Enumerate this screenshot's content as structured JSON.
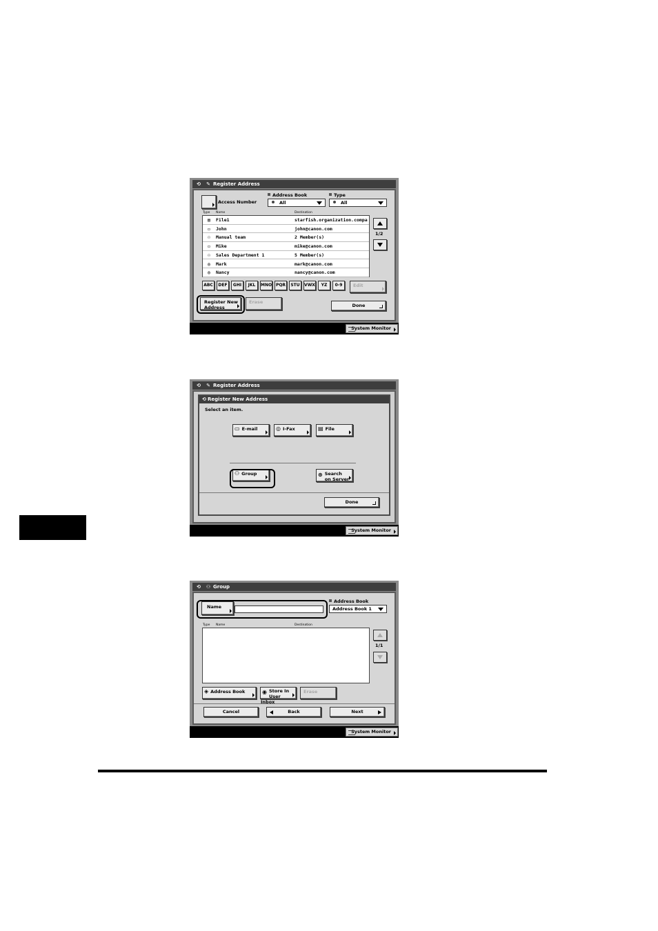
{
  "screen1": {
    "title": "Register Address",
    "access_number_label": "Access Number",
    "address_book_label": "Address Book",
    "address_book_value": "All",
    "type_label": "Type",
    "type_value": "All",
    "columns": [
      "Type",
      "Name",
      "Destination"
    ],
    "rows": [
      {
        "icon": "file-icon",
        "glyph": "▤",
        "name": "File1",
        "destination": "starfish.organization.compa"
      },
      {
        "icon": "email-icon",
        "glyph": "▭",
        "name": "John",
        "destination": "john@canon.com"
      },
      {
        "icon": "group-icon",
        "glyph": "⚇",
        "name": "Manual team",
        "destination": "2 Member(s)"
      },
      {
        "icon": "email-icon",
        "glyph": "▭",
        "name": "Mike",
        "destination": "mike@canon.com"
      },
      {
        "icon": "group-icon",
        "glyph": "⚇",
        "name": "Sales Department 1",
        "destination": "5 Member(s)"
      },
      {
        "icon": "ifax-icon",
        "glyph": "◎",
        "name": "Mark",
        "destination": "mark@canon.com"
      },
      {
        "icon": "ifax-icon",
        "glyph": "◎",
        "name": "Nancy",
        "destination": "nancy@canon.com"
      }
    ],
    "page_indicator": "1/2",
    "index_keys": [
      "ABC",
      "DEF",
      "GHI",
      "JKL",
      "MNO",
      "PQR",
      "STU",
      "VWX",
      "YZ",
      "0-9"
    ],
    "edit_label": "Edit",
    "register_new_line1": "Register New",
    "register_new_line2": "Address",
    "erase_label": "Erase",
    "done_label": "Done",
    "system_monitor_label": "System Monitor"
  },
  "screen2": {
    "title": "Register Address",
    "dialog_title": "Register New Address",
    "instruction": "Select an item.",
    "email_label": "E-mail",
    "ifax_label": "I-Fax",
    "file_label": "File",
    "group_label": "Group",
    "search_line1": "Search",
    "search_line2": "on Server",
    "done_label": "Done",
    "system_monitor_label": "System Monitor"
  },
  "screen3": {
    "title": "Group",
    "name_label": "Name",
    "name_value": "",
    "address_book_label": "Address Book",
    "address_book_value": "Address Book 1",
    "columns": [
      "Type",
      "Name",
      "Destination"
    ],
    "page_indicator": "1/1",
    "address_book_button": "Address Book",
    "store_line1": "Store In",
    "store_line2": "User Inbox",
    "erase_label": "Erase",
    "cancel_label": "Cancel",
    "back_label": "Back",
    "next_label": "Next",
    "system_monitor_label": "System Monitor"
  }
}
